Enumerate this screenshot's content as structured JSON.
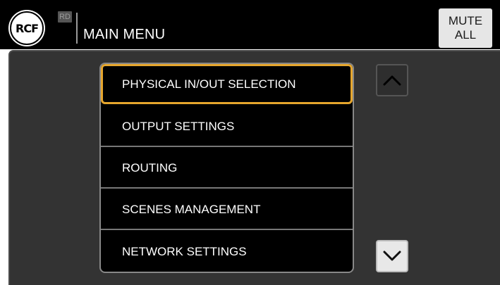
{
  "header": {
    "logo_text": "RCF",
    "badge": "RD",
    "title": "MAIN MENU",
    "mute_button": {
      "line1": "MUTE",
      "line2": "ALL"
    }
  },
  "menu": {
    "items": [
      {
        "label": "PHYSICAL IN/OUT SELECTION",
        "selected": true
      },
      {
        "label": "OUTPUT SETTINGS",
        "selected": false
      },
      {
        "label": "ROUTING",
        "selected": false
      },
      {
        "label": "SCENES MANAGEMENT",
        "selected": false
      },
      {
        "label": "NETWORK SETTINGS",
        "selected": false
      }
    ]
  },
  "scroll": {
    "up_icon": "chevron-up-icon",
    "down_icon": "chevron-down-icon"
  },
  "colors": {
    "selection": "#e6a62d",
    "background": "#333333",
    "menu_background": "#000000"
  }
}
